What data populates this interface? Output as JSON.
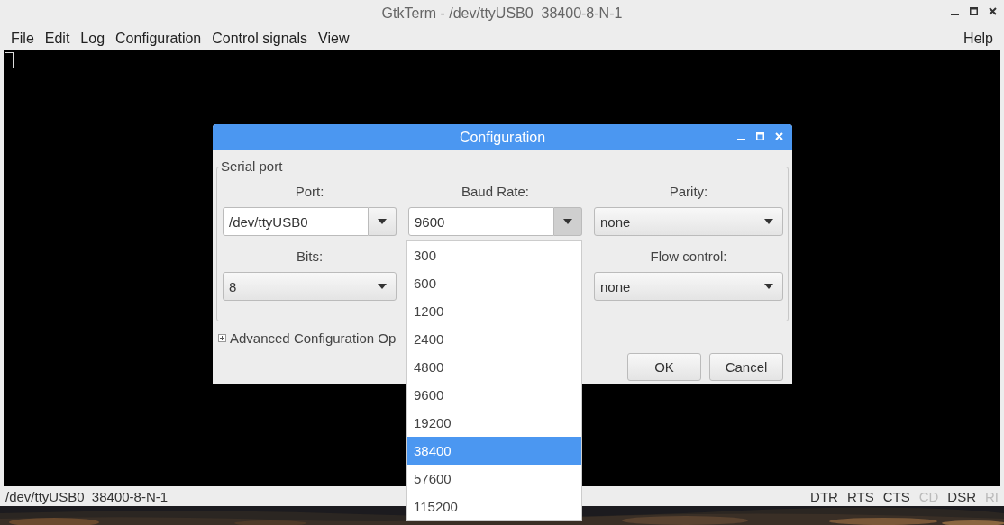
{
  "window": {
    "title": "GtkTerm - /dev/ttyUSB0  38400-8-N-1"
  },
  "menu": [
    {
      "label": "File"
    },
    {
      "label": "Edit"
    },
    {
      "label": "Log"
    },
    {
      "label": "Configuration"
    },
    {
      "label": "Control signals"
    },
    {
      "label": "View"
    }
  ],
  "help_menu": {
    "label": "Help"
  },
  "dialog": {
    "title": "Configuration",
    "section": "Serial port",
    "rows": [
      [
        {
          "label": "Port:",
          "value": "/dev/ttyUSB0",
          "kind": "entry",
          "pressed": false
        },
        {
          "label": "Baud Rate:",
          "value": "9600",
          "kind": "entry",
          "pressed": true
        },
        {
          "label": "Parity:",
          "value": "none",
          "kind": "combo",
          "pressed": false
        }
      ],
      [
        {
          "label": "Bits:",
          "value": "8",
          "kind": "combo",
          "pressed": false
        },
        null,
        {
          "label": "Flow control:",
          "value": "none",
          "kind": "combo",
          "pressed": false
        }
      ]
    ],
    "expander": {
      "label": "Advanced Configuration Op",
      "expanded": false
    },
    "buttons": [
      "OK",
      "Cancel"
    ]
  },
  "dropdown": {
    "items": [
      {
        "label": "300",
        "selected": false
      },
      {
        "label": "600",
        "selected": false
      },
      {
        "label": "1200",
        "selected": false
      },
      {
        "label": "2400",
        "selected": false
      },
      {
        "label": "4800",
        "selected": false
      },
      {
        "label": "9600",
        "selected": false
      },
      {
        "label": "19200",
        "selected": false
      },
      {
        "label": "38400",
        "selected": true
      },
      {
        "label": "57600",
        "selected": false
      },
      {
        "label": "115200",
        "selected": false
      }
    ]
  },
  "status_bar": {
    "port_info": "/dev/ttyUSB0  38400-8-N-1",
    "signals": [
      {
        "label": "DTR",
        "on": true
      },
      {
        "label": "RTS",
        "on": true
      },
      {
        "label": "CTS",
        "on": true
      },
      {
        "label": "CD",
        "on": false
      },
      {
        "label": "DSR",
        "on": true
      },
      {
        "label": "RI",
        "on": false
      }
    ]
  }
}
